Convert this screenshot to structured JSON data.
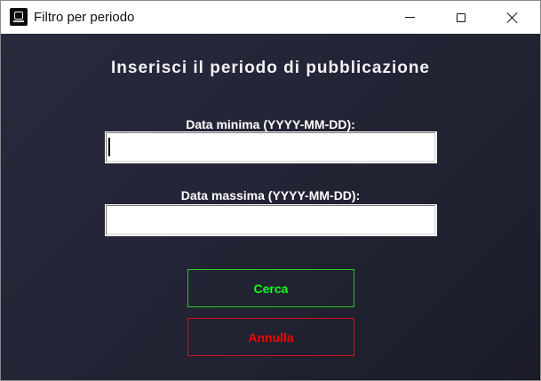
{
  "window": {
    "title": "Filtro per periodo",
    "icon": "app-icon",
    "controls": {
      "minimize_icon": "minimize-icon",
      "maximize_icon": "maximize-icon",
      "close_icon": "close-icon"
    }
  },
  "form": {
    "heading": "Inserisci il periodo di pubblicazione",
    "min_date": {
      "label": "Data minima (YYYY-MM-DD):",
      "value": "",
      "placeholder": ""
    },
    "max_date": {
      "label": "Data massima (YYYY-MM-DD):",
      "value": "",
      "placeholder": ""
    }
  },
  "buttons": {
    "search": "Cerca",
    "cancel": "Annulla"
  },
  "colors": {
    "background": "#232536",
    "search_accent": "#12ff12",
    "cancel_accent": "#ff0000"
  }
}
